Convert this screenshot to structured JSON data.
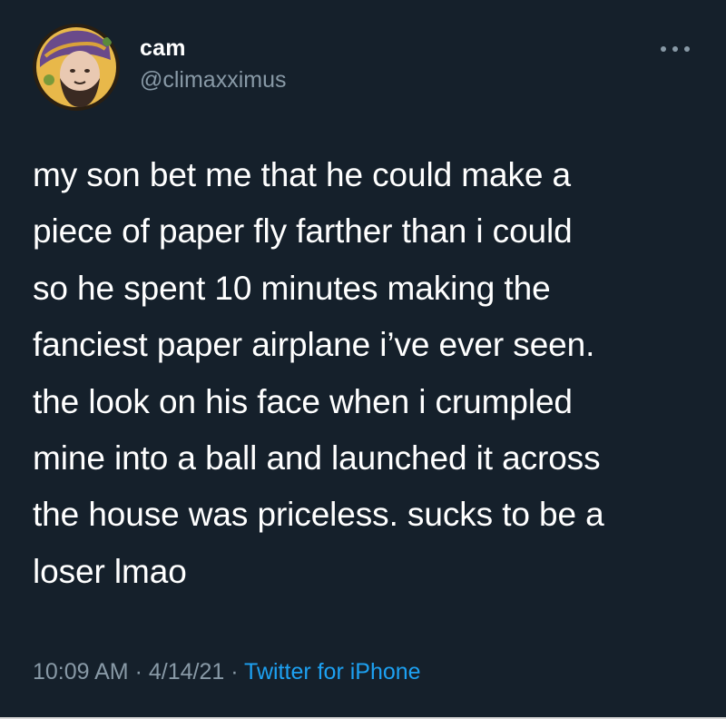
{
  "user": {
    "display_name": "cam",
    "handle": "@climaxximus",
    "avatar_icon": "avatar-image"
  },
  "menu": {
    "icon": "more-options-icon"
  },
  "tweet": {
    "lines": [
      "my son bet me that he could make a",
      "piece of paper fly farther than i could",
      "so he spent 10 minutes making the",
      "fanciest paper airplane i’ve ever seen.",
      "the look on his face when i crumpled",
      "mine into a ball and launched it across",
      "the house was priceless. sucks to be a",
      "loser lmao"
    ]
  },
  "meta": {
    "time": "10:09 AM",
    "separator": " · ",
    "date": "4/14/21",
    "source": "Twitter for iPhone"
  },
  "colors": {
    "background": "#15202b",
    "text": "#ffffff",
    "secondary": "#8899a6",
    "link": "#1da1f2"
  }
}
